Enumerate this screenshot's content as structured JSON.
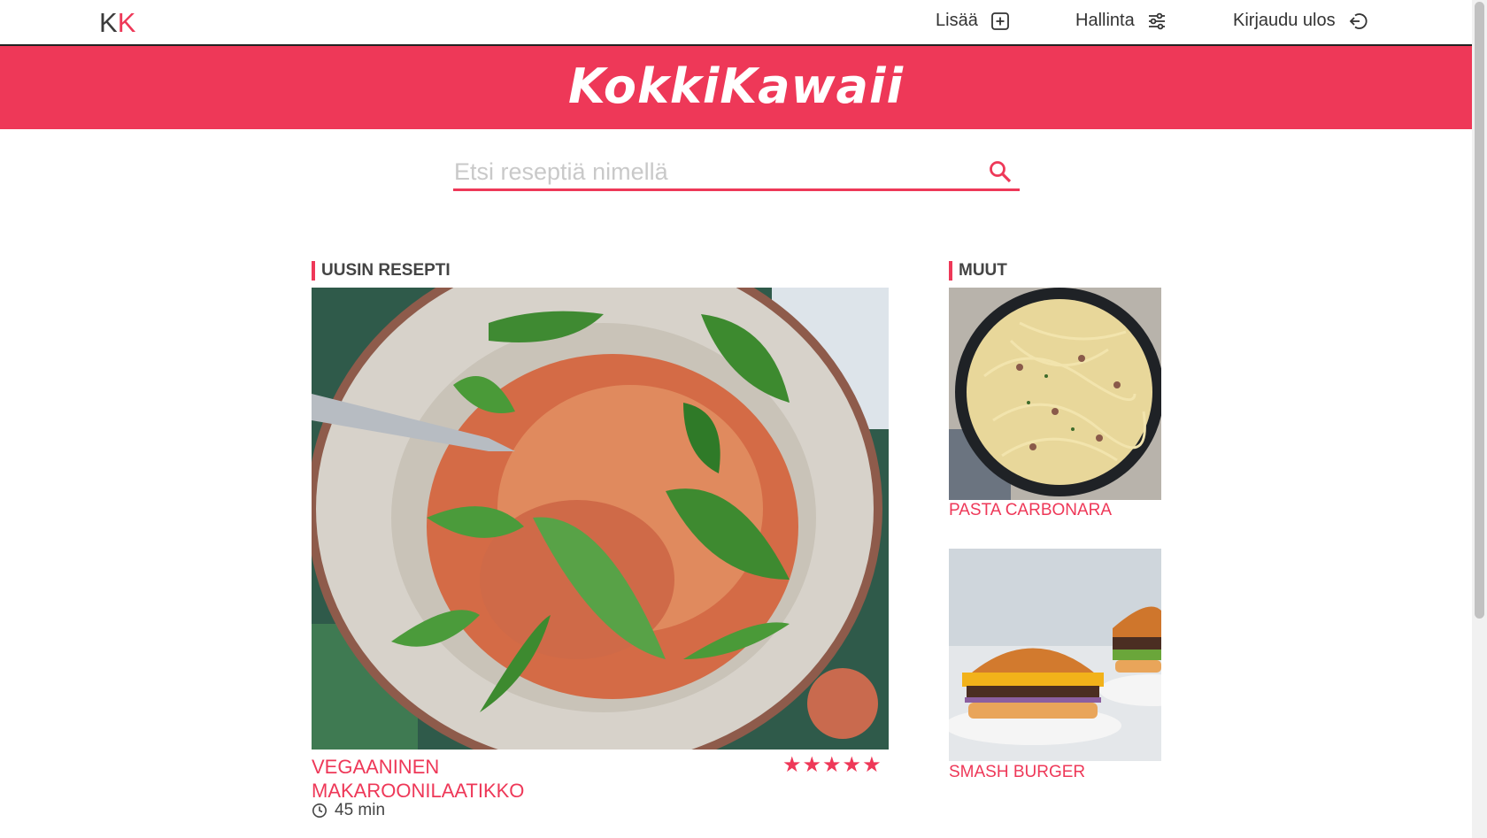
{
  "nav": {
    "logo_k1": "K",
    "logo_k2": "K",
    "add_label": "Lisää",
    "add_icon": "plus-square-icon",
    "manage_label": "Hallinta",
    "manage_icon": "sliders-icon",
    "logout_label": "Kirjaudu ulos",
    "logout_icon": "logout-icon"
  },
  "banner": {
    "title": "KokkiKawaii"
  },
  "search": {
    "placeholder": "Etsi reseptiä nimellä",
    "value": "",
    "icon": "search-icon"
  },
  "latest": {
    "section_label": "UUSIN RESEPTI",
    "title": "VEGAANINEN MAKAROONILAATIKKO",
    "time": "45 min",
    "time_icon": "clock-icon",
    "rating": 5,
    "rating_max": 5,
    "image": "macaroni-bowl-photo"
  },
  "others": {
    "section_label": "MUUT",
    "items": [
      {
        "title": "PASTA CARBONARA",
        "image": "carbonara-photo"
      },
      {
        "title": "SMASH BURGER",
        "image": "burger-photo"
      }
    ]
  },
  "colors": {
    "accent": "#ee3858",
    "text": "#333333",
    "placeholder": "#c9c9c9"
  }
}
